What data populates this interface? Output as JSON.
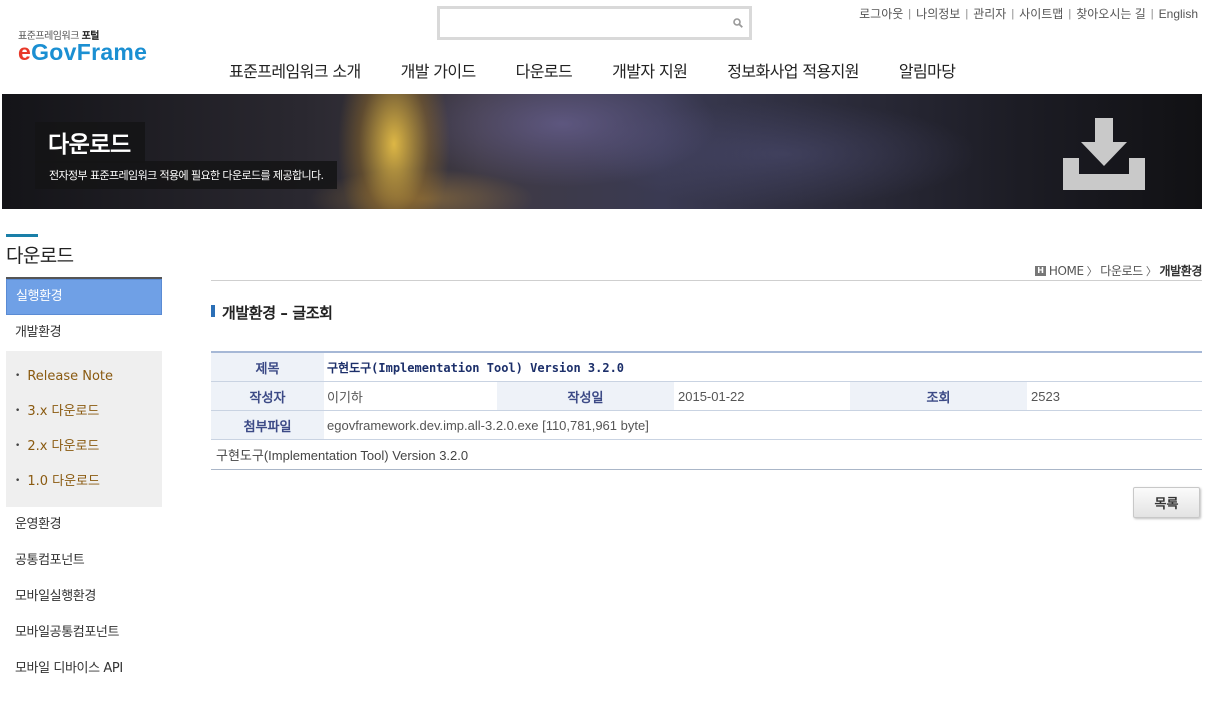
{
  "logo": {
    "sub_prefix": "표준프레임워크 ",
    "sub_strong": "포털",
    "main_e": "e",
    "main_rest": "GovFrame"
  },
  "search": {
    "value": "",
    "placeholder": ""
  },
  "util_links": [
    "로그아웃",
    "나의정보",
    "관리자",
    "사이트맵",
    "찾아오시는 길",
    "English"
  ],
  "gnb": [
    "표준프레임워크 소개",
    "개발 가이드",
    "다운로드",
    "개발자 지원",
    "정보화사업 적용지원",
    "알림마당"
  ],
  "banner": {
    "title": "다운로드",
    "desc": "전자정부 표준프레임워크 적용에 필요한 다운로드를 제공합니다."
  },
  "lnb": {
    "title": "다운로드",
    "active_item": "실행환경",
    "item_dev": "개발환경",
    "sub_items": [
      "Release Note",
      "3.x 다운로드",
      "2.x 다운로드",
      "1.0 다운로드"
    ],
    "items_after": [
      "운영환경",
      "공통컴포넌트",
      "모바일실행환경",
      "모바일공통컴포넌트",
      "모바일 디바이스 API"
    ]
  },
  "breadcrumb": {
    "home_icon": "H",
    "home": "HOME",
    "level1": "다운로드",
    "current": "개발환경"
  },
  "page_title": "개발환경 – 글조회",
  "post": {
    "subject_label": "제목",
    "subject": "구현도구(Implementation Tool) Version 3.2.0",
    "author_label": "작성자",
    "author": "이기하",
    "date_label": "작성일",
    "date": "2015-01-22",
    "views_label": "조회",
    "views": "2523",
    "attach_label": "첨부파일",
    "attachment": "egovframework.dev.imp.all-3.2.0.exe [110,781,961 byte]",
    "content": "구현도구(Implementation Tool) Version 3.2.0"
  },
  "list_button": "목록",
  "colors": {
    "accent": "#1a7fa8",
    "active_nav": "#6fa0e6",
    "table_header_text": "#3c4a86",
    "sub_link": "#8a5a10"
  }
}
